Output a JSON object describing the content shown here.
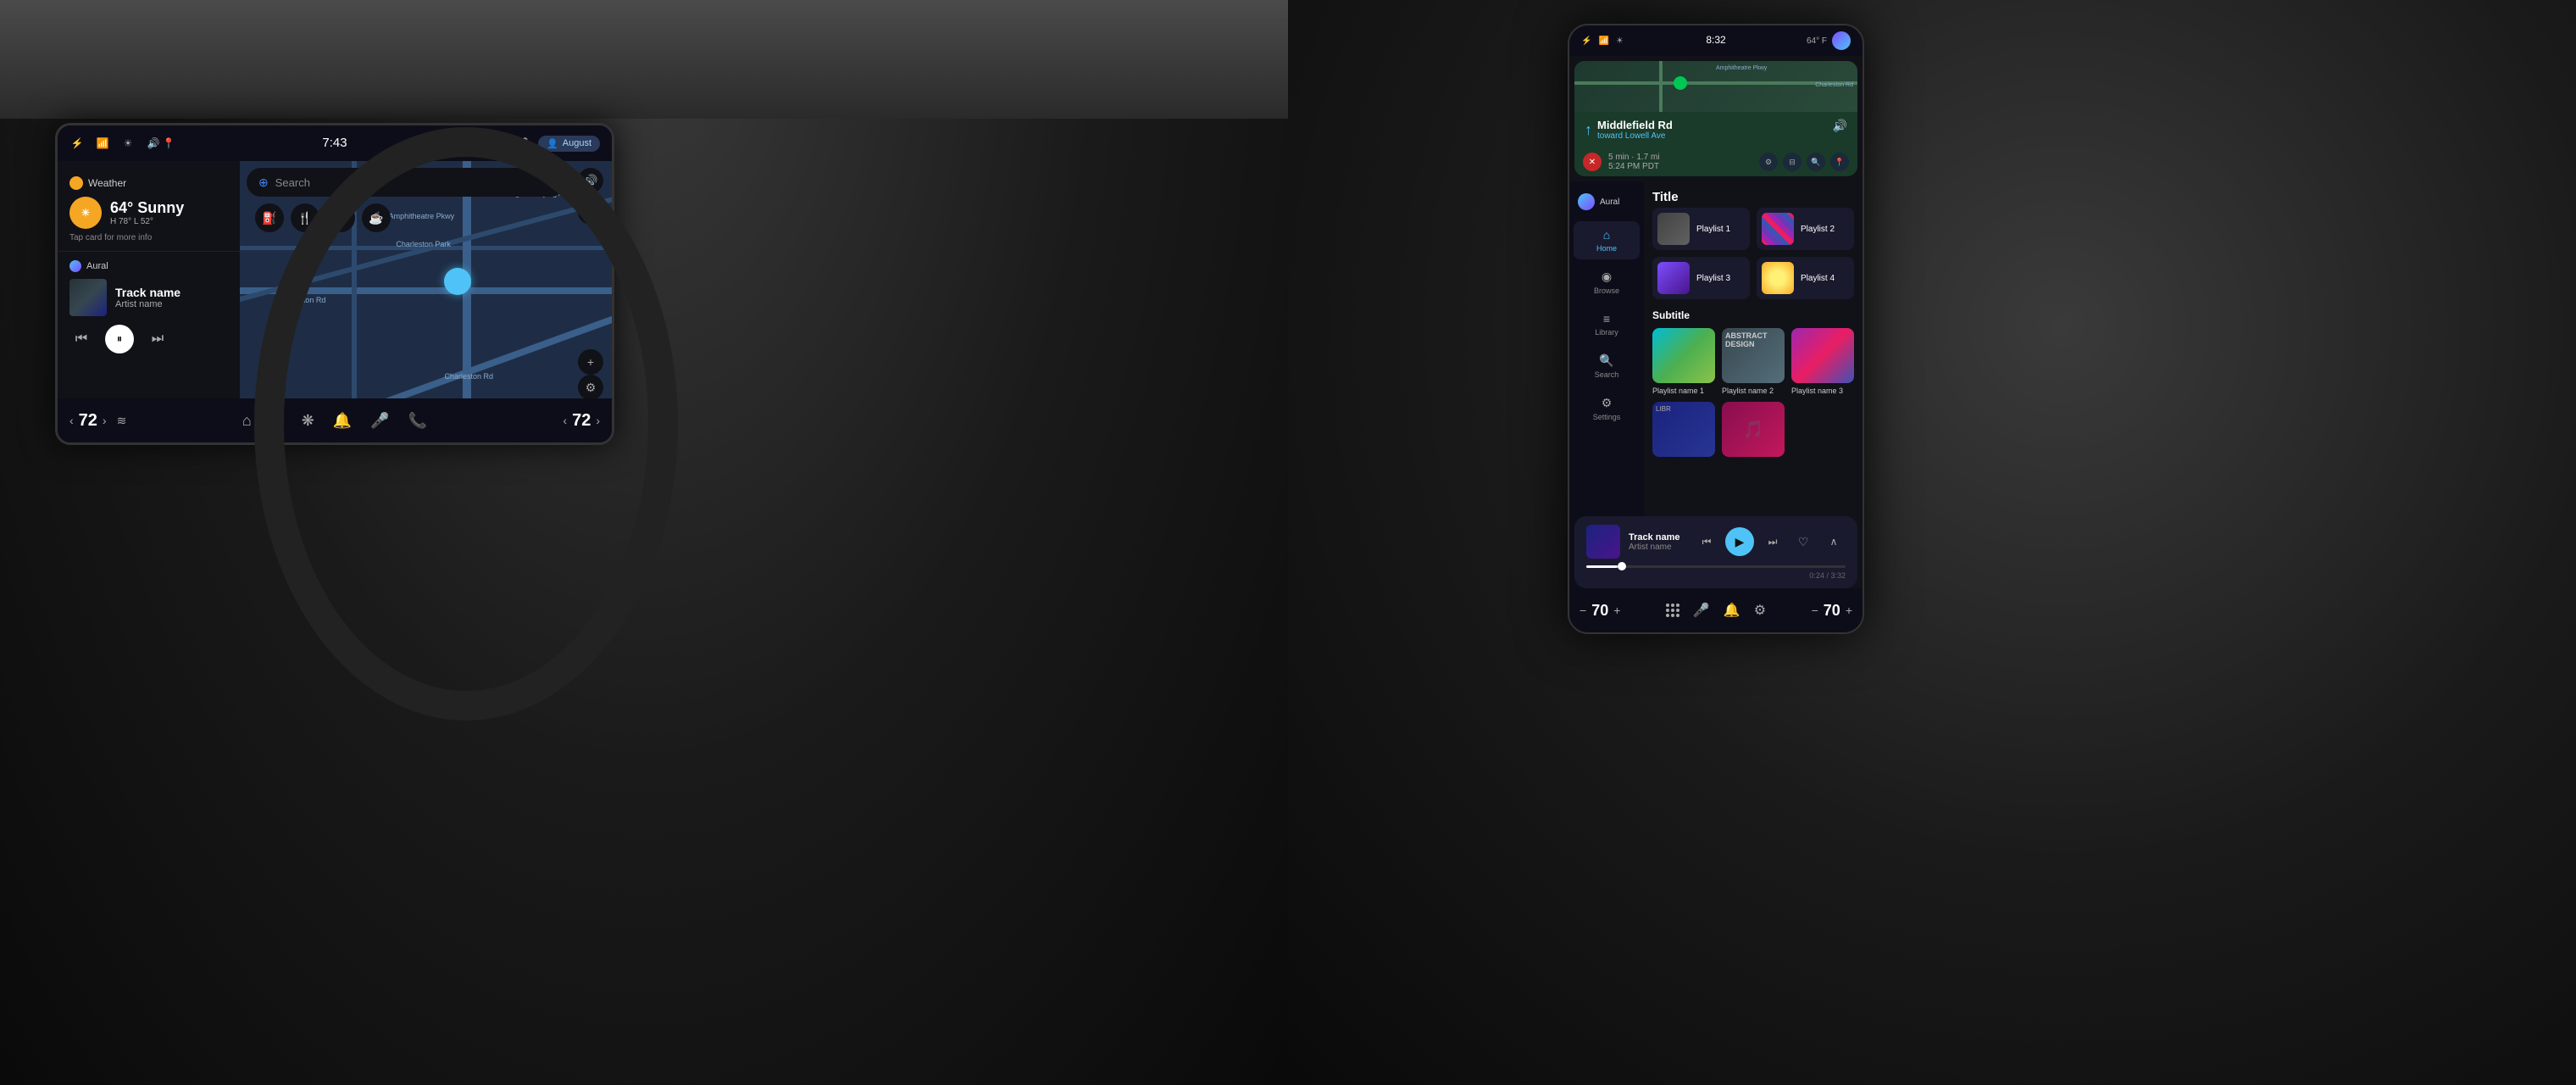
{
  "leftPanel": {
    "screen": {
      "time": "7:43",
      "statusIcons": [
        "bluetooth",
        "signal",
        "brightness",
        "volume"
      ],
      "user": "August",
      "micIcon": "mic-icon"
    },
    "weather": {
      "title": "Weather",
      "temperature": "64°",
      "condition": "Sunny",
      "high": "H 78°",
      "low": "L 52°",
      "tapHint": "Tap card for more info"
    },
    "music": {
      "appName": "Aural",
      "trackName": "Track name",
      "artistName": "Artist name"
    },
    "controls": {
      "prev": "⏮",
      "play": "⏸",
      "next": "⏭"
    },
    "search": {
      "placeholder": "Search"
    },
    "taskbar": {
      "tempLeft": "72",
      "tempRight": "72",
      "navItems": [
        "home",
        "apps",
        "fan",
        "bell",
        "mic",
        "phone"
      ]
    }
  },
  "rightPanel": {
    "phone": {
      "time": "8:32",
      "temperature": "64° F",
      "statusIcons": [
        "bluetooth",
        "signal",
        "brightness"
      ]
    },
    "navigation": {
      "street": "Middlefield Rd",
      "toward": "toward Lowell Ave",
      "eta": "5 min · 1.7 mi",
      "etaTime": "5:24 PM PDT"
    },
    "musicApp": {
      "appName": "Aural",
      "sectionTitle": "Title",
      "sectionSubtitle": "Subtitle",
      "navItems": [
        {
          "label": "Home",
          "icon": "home"
        },
        {
          "label": "Browse",
          "icon": "browse"
        },
        {
          "label": "Library",
          "icon": "library"
        },
        {
          "label": "Search",
          "icon": "search"
        },
        {
          "label": "Settings",
          "icon": "settings"
        }
      ],
      "playlists": [
        {
          "name": "Playlist 1",
          "thumb": "1"
        },
        {
          "name": "Playlist 2",
          "thumb": "2"
        },
        {
          "name": "Playlist 3",
          "thumb": "3"
        },
        {
          "name": "Playlist 4",
          "thumb": "4"
        }
      ],
      "browseItems": [
        {
          "name": "Playlist name 1",
          "thumb": "1"
        },
        {
          "name": "Playlist name 2",
          "thumb": "2"
        },
        {
          "name": "Playlist name 3",
          "thumb": "3"
        }
      ]
    },
    "nowPlaying": {
      "trackName": "Track name",
      "artistName": "Artist name",
      "currentTime": "0:24",
      "totalTime": "3:32"
    },
    "taskbar": {
      "tempLeft": "70",
      "tempRight": "70"
    }
  }
}
